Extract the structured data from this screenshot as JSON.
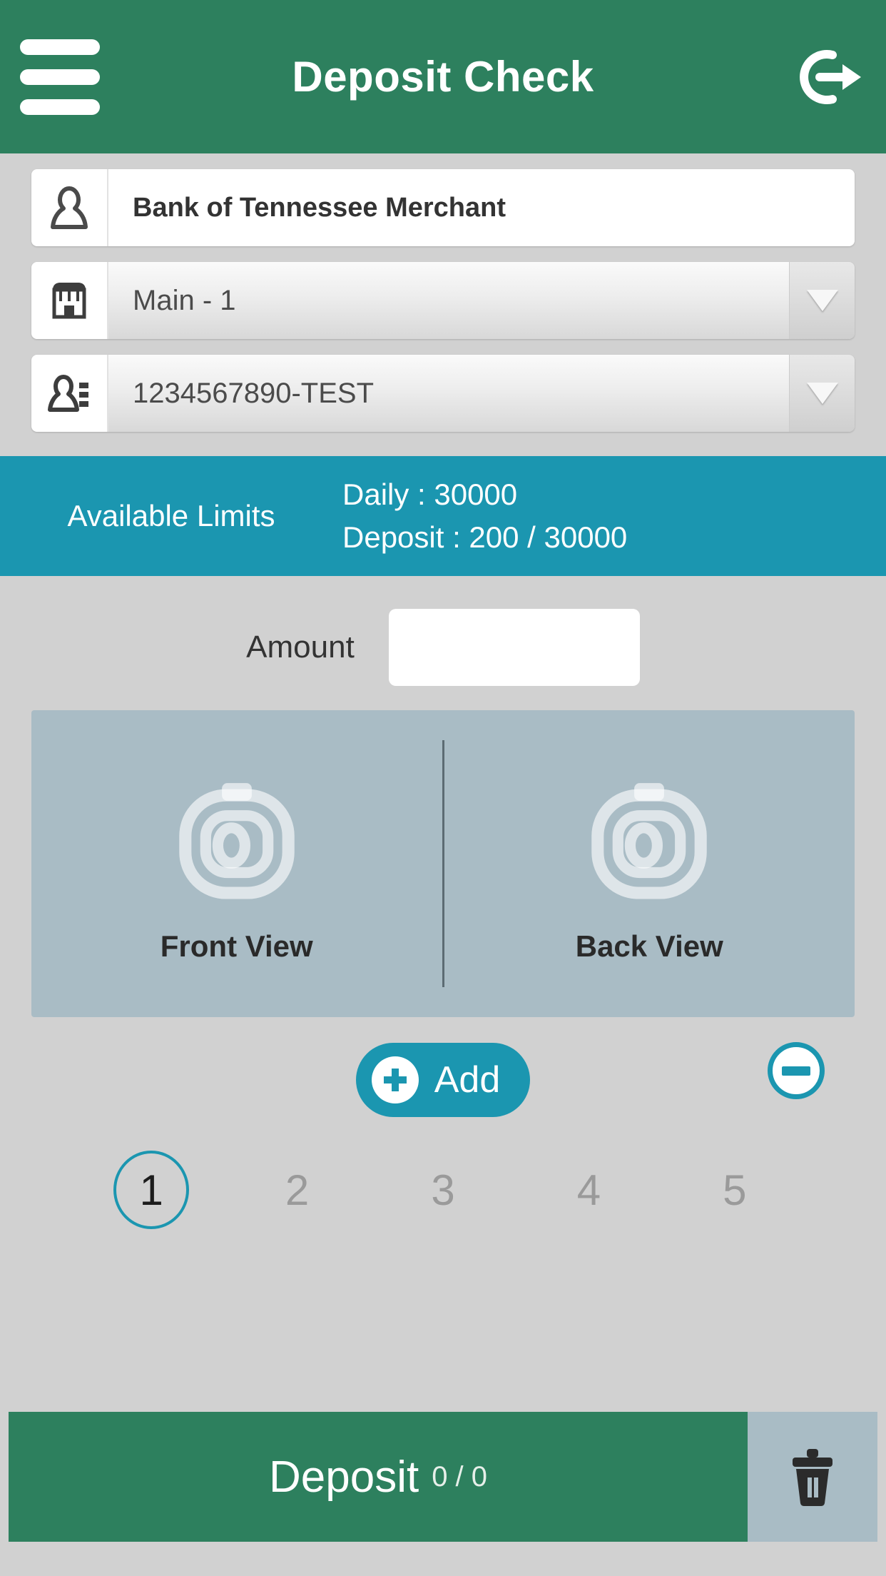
{
  "header": {
    "title": "Deposit Check",
    "menu_icon": "hamburger-menu-icon",
    "logout_icon": "logout-icon"
  },
  "form": {
    "merchant": {
      "icon": "person-icon",
      "value": "Bank of Tennessee Merchant"
    },
    "location": {
      "icon": "store-icon",
      "value": "Main - 1",
      "arrow_icon": "chevron-down-icon"
    },
    "account": {
      "icon": "account-list-icon",
      "value": "1234567890-TEST",
      "arrow_icon": "chevron-down-icon"
    }
  },
  "limits": {
    "label": "Available Limits",
    "daily": "Daily : 30000",
    "deposit": "Deposit : 200 / 30000"
  },
  "amount": {
    "label": "Amount",
    "value": "",
    "placeholder": ""
  },
  "capture": {
    "front": {
      "label": "Front View",
      "icon": "camera-icon"
    },
    "back": {
      "label": "Back View",
      "icon": "camera-icon"
    }
  },
  "actions": {
    "add_label": "Add",
    "add_icon": "plus-circle-icon",
    "remove_icon": "minus-circle-icon"
  },
  "pagination": {
    "pages": [
      "1",
      "2",
      "3",
      "4",
      "5"
    ],
    "active_index": 0
  },
  "bottom": {
    "deposit_label": "Deposit",
    "deposit_count": "0 / 0",
    "trash_icon": "trash-icon"
  },
  "colors": {
    "header_green": "#2d805e",
    "accent_teal": "#1b96b0",
    "panel_blue_gray": "#a9bcc5",
    "page_background": "#d1d1d1"
  }
}
